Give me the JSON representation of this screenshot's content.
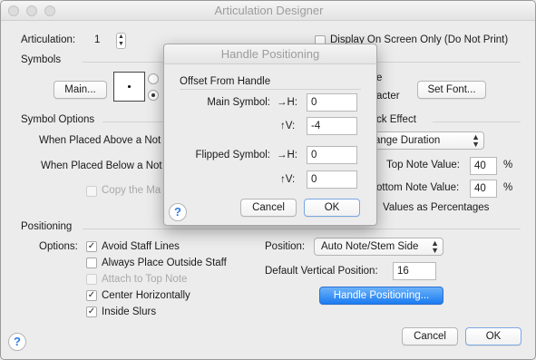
{
  "window": {
    "title": "Articulation Designer"
  },
  "articulation": {
    "label": "Articulation:",
    "value": "1"
  },
  "display_on_screen": {
    "label": "Display On Screen Only (Do Not Print)",
    "checked": false
  },
  "symbols": {
    "section": "Symbols",
    "main_button": "Main...",
    "font_fragment_1": "e",
    "font_fragment_2": "acter",
    "set_font_button": "Set Font..."
  },
  "symbol_options": {
    "section": "Symbol Options",
    "above_label": "When Placed Above a Not",
    "below_label": "When Placed Below a Not",
    "copy_label": "Copy the Ma",
    "copy_checked": false
  },
  "playback": {
    "section_fragment": "ck Effect",
    "effect_value": "ange Duration",
    "top_note_label": "Top Note Value:",
    "top_note_value": "40",
    "bottom_note_label": "ottom Note Value:",
    "bottom_note_value": "40",
    "percent": "%",
    "values_label": "Values as Percentages"
  },
  "positioning": {
    "section": "Positioning",
    "options_label": "Options:",
    "options": [
      {
        "label": "Avoid Staff Lines",
        "checked": true,
        "disabled": false
      },
      {
        "label": "Always Place Outside Staff",
        "checked": false,
        "disabled": false
      },
      {
        "label": "Attach to Top Note",
        "checked": false,
        "disabled": true
      },
      {
        "label": "Center Horizontally",
        "checked": true,
        "disabled": false
      },
      {
        "label": "Inside Slurs",
        "checked": true,
        "disabled": false
      }
    ],
    "position_label": "Position:",
    "position_value": "Auto Note/Stem Side",
    "default_vertical_label": "Default Vertical Position:",
    "default_vertical_value": "16",
    "handle_button": "Handle Positioning..."
  },
  "footer": {
    "cancel": "Cancel",
    "ok": "OK",
    "help": "?"
  },
  "sheet": {
    "title": "Handle Positioning",
    "group": "Offset From Handle",
    "main_symbol_label": "Main Symbol:",
    "h_label": "→H:",
    "v_label": "↑V:",
    "main_h": "0",
    "main_v": "-4",
    "flipped_symbol_label": "Flipped Symbol:",
    "flipped_h": "0",
    "flipped_v": "0",
    "cancel": "Cancel",
    "ok": "OK",
    "help": "?"
  },
  "colors": {
    "accent": "#1b7bf0",
    "title_text": "#9c9c9c",
    "background": "#ececec"
  },
  "icons": [
    "stepper-icon",
    "chevron-updown-icon",
    "help-icon",
    "checkmark-icon"
  ]
}
